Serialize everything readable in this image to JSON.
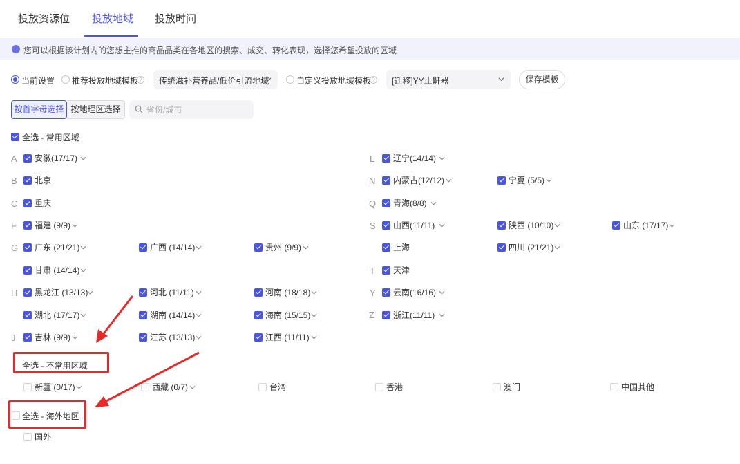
{
  "tabs": [
    "投放资源位",
    "投放地域",
    "投放时间"
  ],
  "notice": "您可以根据该计划内的您想主推的商品品类在各地区的搜索、成交、转化表现，选择您希望投放的区域",
  "options": {
    "current": "当前设置",
    "recommend": "推荐投放地域模板",
    "recommend_value": "传统滋补营养品/低价引流地域",
    "custom": "自定义投放地域模板",
    "custom_value": "[迁移]YY止鼾器",
    "save": "保存模板"
  },
  "view": {
    "by_letter": "按首字母选择",
    "by_region": "按地理区选择",
    "search_placeholder": "省份/城市"
  },
  "groups": {
    "common": "全选 - 常用区域",
    "uncommon": "全选 - 不常用区域",
    "overseas": "全选 - 海外地区"
  },
  "left_letters": [
    "A",
    "B",
    "C",
    "F",
    "G",
    "H",
    "J"
  ],
  "right_letters": [
    "L",
    "N",
    "Q",
    "S",
    "T",
    "Y",
    "Z"
  ],
  "regions": [
    {
      "name": "安徽(17/17)",
      "checked": true,
      "dropdown": true
    },
    {
      "name": "北京",
      "checked": true,
      "dropdown": false
    },
    {
      "name": "重庆",
      "checked": true,
      "dropdown": false
    },
    {
      "name": "福建 (9/9)",
      "checked": true,
      "dropdown": true
    },
    {
      "name": "广东 (21/21)",
      "checked": true,
      "dropdown": true
    },
    {
      "name": "广西 (14/14)",
      "checked": true,
      "dropdown": true
    },
    {
      "name": "贵州 (9/9)",
      "checked": true,
      "dropdown": true
    },
    {
      "name": "甘肃 (14/14)",
      "checked": true,
      "dropdown": true
    },
    {
      "name": "黑龙江 (13/13)",
      "checked": true,
      "dropdown": true
    },
    {
      "name": "河北 (11/11)",
      "checked": true,
      "dropdown": true
    },
    {
      "name": "河南 (18/18)",
      "checked": true,
      "dropdown": true
    },
    {
      "name": "湖北 (17/17)",
      "checked": true,
      "dropdown": true
    },
    {
      "name": "湖南 (14/14)",
      "checked": true,
      "dropdown": true
    },
    {
      "name": "海南 (15/15)",
      "checked": true,
      "dropdown": true
    },
    {
      "name": "吉林 (9/9)",
      "checked": true,
      "dropdown": true
    },
    {
      "name": "江苏 (13/13)",
      "checked": true,
      "dropdown": true
    },
    {
      "name": "江西 (11/11)",
      "checked": true,
      "dropdown": true
    },
    {
      "name": "辽宁(14/14)",
      "checked": true,
      "dropdown": true
    },
    {
      "name": "内蒙古(12/12)",
      "checked": true,
      "dropdown": true
    },
    {
      "name": "宁夏 (5/5)",
      "checked": true,
      "dropdown": true
    },
    {
      "name": "青海(8/8)",
      "checked": true,
      "dropdown": true
    },
    {
      "name": "山西(11/11)",
      "checked": true,
      "dropdown": true
    },
    {
      "name": "陕西 (10/10)",
      "checked": true,
      "dropdown": true
    },
    {
      "name": "山东 (17/17)",
      "checked": true,
      "dropdown": true
    },
    {
      "name": "上海",
      "checked": true,
      "dropdown": false
    },
    {
      "name": "四川 (21/21)",
      "checked": true,
      "dropdown": true
    },
    {
      "name": "天津",
      "checked": true,
      "dropdown": false
    },
    {
      "name": "云南(16/16)",
      "checked": true,
      "dropdown": true
    },
    {
      "name": "浙江(11/11)",
      "checked": true,
      "dropdown": true
    },
    {
      "name": "新疆 (0/17)",
      "checked": false,
      "dropdown": true
    },
    {
      "name": "西藏 (0/7)",
      "checked": false,
      "dropdown": true
    },
    {
      "name": "台湾",
      "checked": false,
      "dropdown": false
    },
    {
      "name": "香港",
      "checked": false,
      "dropdown": false
    },
    {
      "name": "澳门",
      "checked": false,
      "dropdown": false
    },
    {
      "name": "中国其他",
      "checked": false,
      "dropdown": false
    },
    {
      "name": "国外",
      "checked": false,
      "dropdown": false
    }
  ],
  "colors": {
    "accent": "#4a55e0",
    "highlight": "#e62a2a"
  }
}
